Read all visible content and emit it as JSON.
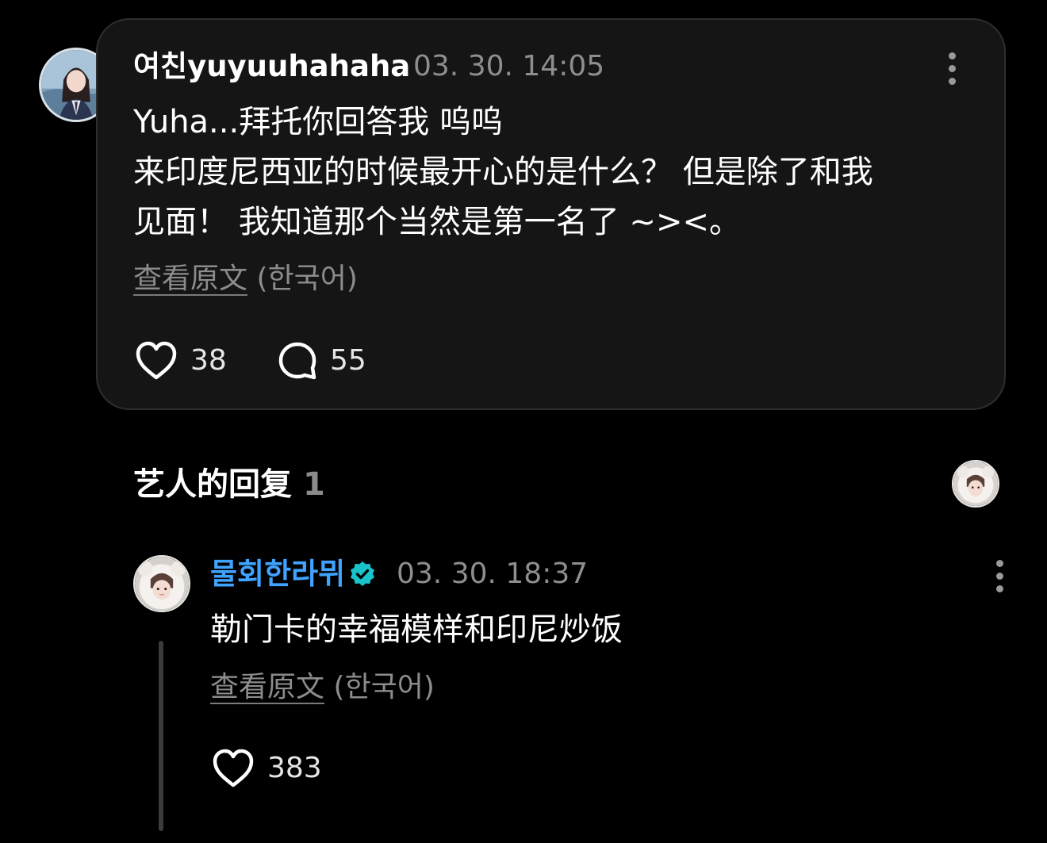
{
  "colors": {
    "background": "#000000",
    "card": "#151515",
    "artist_name": "#3fa3ff",
    "verified_badge": "#19c3c9",
    "muted": "#8e8e8e"
  },
  "fan_comment": {
    "username": "여친yuyuuhahaha",
    "timestamp": "03. 30. 14:05",
    "avatar_icon": "user-avatar",
    "more_icon": "more-vertical-icon",
    "lines": [
      "Yuha...拜托你回答我 呜呜",
      "来印度尼西亚的时候最开心的是什么？ 但是除了和我",
      "见面！ 我知道那个当然是第一名了 ~><。"
    ],
    "view_original_label": "查看原文",
    "original_language": "(한국어)",
    "like_icon": "heart-icon",
    "like_count": "38",
    "comment_icon": "comment-bubble-icon",
    "comment_count": "55"
  },
  "artist_replies": {
    "title": "艺人的回复",
    "count": "1",
    "replies": [
      {
        "username": "물회한라뮈",
        "verified_icon": "verified-badge-icon",
        "timestamp": "03. 30. 18:37",
        "text": "勒门卡的幸福模样和印尼炒饭",
        "view_original_label": "查看原文",
        "original_language": "(한국어)",
        "like_icon": "heart-icon",
        "like_count": "383",
        "more_icon": "more-vertical-icon"
      }
    ]
  }
}
